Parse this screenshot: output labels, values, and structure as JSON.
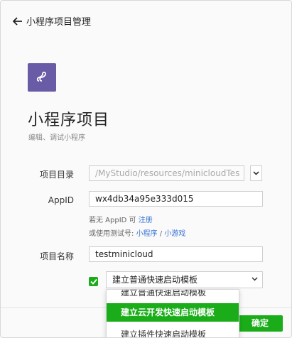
{
  "header": {
    "back_label": "小程序项目管理"
  },
  "project": {
    "title": "小程序项目",
    "subtitle": "编辑、调试小程序"
  },
  "form": {
    "dir_label": "项目目录",
    "dir_value": "/MyStudio/resources/minicloudTes",
    "appid_label": "AppID",
    "appid_value": "wx4db34a95e333d015",
    "hint_no_appid": "若无 AppID 可",
    "register_link": "注册",
    "hint_test": "或使用测试号:",
    "mini_program_link": "小程序",
    "separator": "/",
    "mini_game_link": "小游戏",
    "name_label": "项目名称",
    "name_value": "testminicloud"
  },
  "template_select": {
    "checked": true,
    "selected": "建立普通快速启动模板",
    "options": [
      "建立普通快速启动模板",
      "建立云开发快速启动模板",
      "建立插件快速启动模板"
    ],
    "highlighted": "建立云开发快速启动模板"
  },
  "footer": {
    "confirm_label": "确定"
  },
  "colors": {
    "accent": "#1aad19",
    "logo_bg": "#6a5ba6",
    "link": "#3470d4"
  }
}
